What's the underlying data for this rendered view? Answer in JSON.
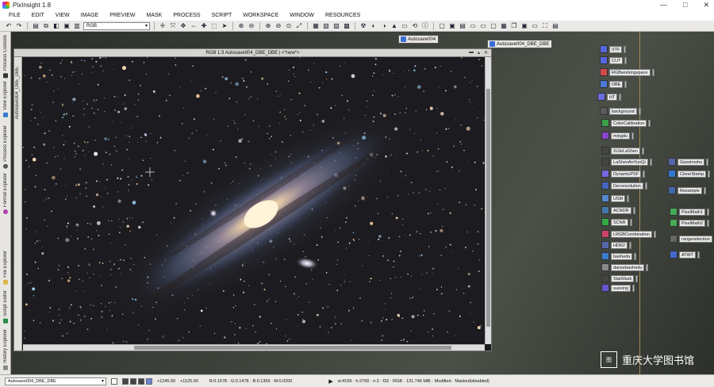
{
  "app": {
    "title": "PixInsight 1.8"
  },
  "menu": [
    "FILE",
    "EDIT",
    "VIEW",
    "IMAGE",
    "PREVIEW",
    "MASK",
    "PROCESS",
    "SCRIPT",
    "WORKSPACE",
    "WINDOW",
    "RESOURCES"
  ],
  "toolbar": {
    "view_mode": "RGB"
  },
  "left_tabs": [
    "Process Console",
    "View Explorer",
    "Process Explorer",
    "Format Explorer",
    "File Explorer",
    "Script Editor",
    "History Explorer"
  ],
  "image_window": {
    "title": "RGB 1:3 Autosave004_DBE_DBE | <*new*>",
    "side_label": "Autosave004_DBE_DBE"
  },
  "doc_tabs": [
    {
      "label": "Autosave004"
    },
    {
      "label": "Autosave004_DBE_DBE"
    }
  ],
  "process_icons": [
    {
      "label": "STF",
      "color": "#5566e0"
    },
    {
      "label": "CUT",
      "color": "#5566e0"
    },
    {
      "label": "RGBworkingspace",
      "color": "#d24a4a"
    },
    {
      "label": "DBE",
      "color": "#4a7ad2"
    },
    {
      "label": "HT",
      "color": "#6b6be0"
    },
    {
      "label": "background",
      "color": "#5a5a5a"
    },
    {
      "label": "ColorCalibration",
      "color": "#3aa04a"
    },
    {
      "label": "mingdu",
      "color": "#8844cc"
    },
    {
      "label": "XiJieLaShen",
      "color": "#444"
    },
    {
      "label": "LaShenAnYunQi",
      "color": "#444"
    },
    {
      "label": "DynamicPSF",
      "color": "#7766dd"
    },
    {
      "label": "Deconvolution",
      "color": "#4466bb"
    },
    {
      "label": "USM",
      "color": "#5588cc"
    },
    {
      "label": "ACNDR",
      "color": "#4477aa"
    },
    {
      "label": "SCNR",
      "color": "#33aa44"
    },
    {
      "label": "LRGBCombination",
      "color": "#cc4466"
    },
    {
      "label": "HDR2",
      "color": "#5566aa"
    },
    {
      "label": "baohedu",
      "color": "#3a7dcc"
    },
    {
      "label": "dansebaohedu",
      "color": "#888"
    },
    {
      "label": "StarMask",
      "color": "#444"
    },
    {
      "label": "suoxing",
      "color": "#6655cc"
    },
    {
      "label": "Gaosimohu",
      "color": "#5566aa"
    },
    {
      "label": "CloneStamp",
      "color": "#3377cc"
    },
    {
      "label": "Resample",
      "color": "#4466aa"
    },
    {
      "label": "PixelMath1",
      "color": "#44aa55"
    },
    {
      "label": "PixelMath2",
      "color": "#44aa55"
    },
    {
      "label": "rangeselection",
      "color": "#666"
    },
    {
      "label": "ATWT",
      "color": "#4466cc"
    }
  ],
  "watermark": {
    "logo_text": "图",
    "text": "重庆大学图书馆"
  },
  "status": {
    "view_name": "Autosave004_DBE_DBE",
    "x": "+1245.00",
    "y": "+1125.00",
    "rgbk": "R:0.1678 · G:0.1478 · B:0.1356 · M:0.0200",
    "info": "w:4159 · h:2768 · n:3 · f32 · RGB · 131.746 MiB · Modified · Masked(disabled)"
  }
}
